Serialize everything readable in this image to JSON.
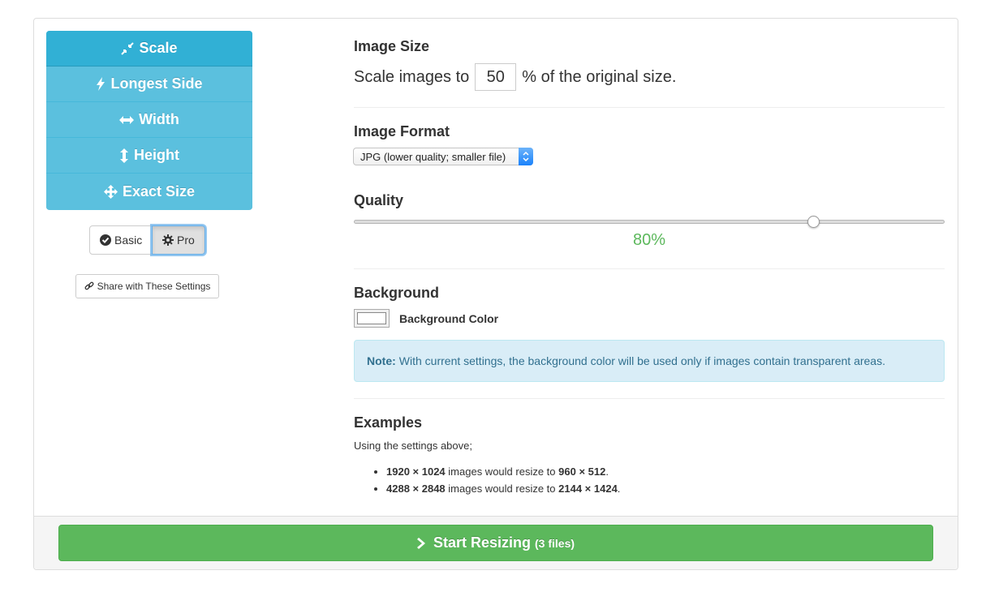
{
  "nav": {
    "items": [
      {
        "label": "Scale",
        "icon": "compress-icon",
        "active": true
      },
      {
        "label": "Longest Side",
        "icon": "bolt-icon",
        "active": false
      },
      {
        "label": "Width",
        "icon": "arrows-horizontal-icon",
        "active": false
      },
      {
        "label": "Height",
        "icon": "arrows-vertical-icon",
        "active": false
      },
      {
        "label": "Exact Size",
        "icon": "arrows-move-icon",
        "active": false
      }
    ]
  },
  "mode": {
    "basic_label": "Basic",
    "pro_label": "Pro",
    "selected": "Pro"
  },
  "share": {
    "label": "Share with These Settings"
  },
  "image_size": {
    "heading": "Image Size",
    "prefix": "Scale images to",
    "value": "50",
    "suffix": "% of the original size."
  },
  "image_format": {
    "heading": "Image Format",
    "selected": "JPG (lower quality; smaller file)"
  },
  "quality": {
    "heading": "Quality",
    "value_label": "80%",
    "value": 80
  },
  "background": {
    "heading": "Background",
    "color_label": "Background Color",
    "color": "#ffffff",
    "note_strong": "Note:",
    "note_text": "With current settings, the background color will be used only if images contain transparent areas."
  },
  "examples": {
    "heading": "Examples",
    "intro": "Using the settings above;",
    "items": [
      {
        "from": "1920 × 1024",
        "middle": "images would resize to",
        "to": "960 × 512",
        "end": "."
      },
      {
        "from": "4288 × 2848",
        "middle": "images would resize to",
        "to": "2144 × 1424",
        "end": "."
      }
    ]
  },
  "footer": {
    "start_label": "Start Resizing",
    "count_label": "(3 files)"
  },
  "colors": {
    "nav_bg": "#5bc0de",
    "nav_active": "#31b0d5",
    "start_green": "#5cb85c",
    "quality_green": "#5cb85c",
    "note_bg": "#d9edf7"
  }
}
